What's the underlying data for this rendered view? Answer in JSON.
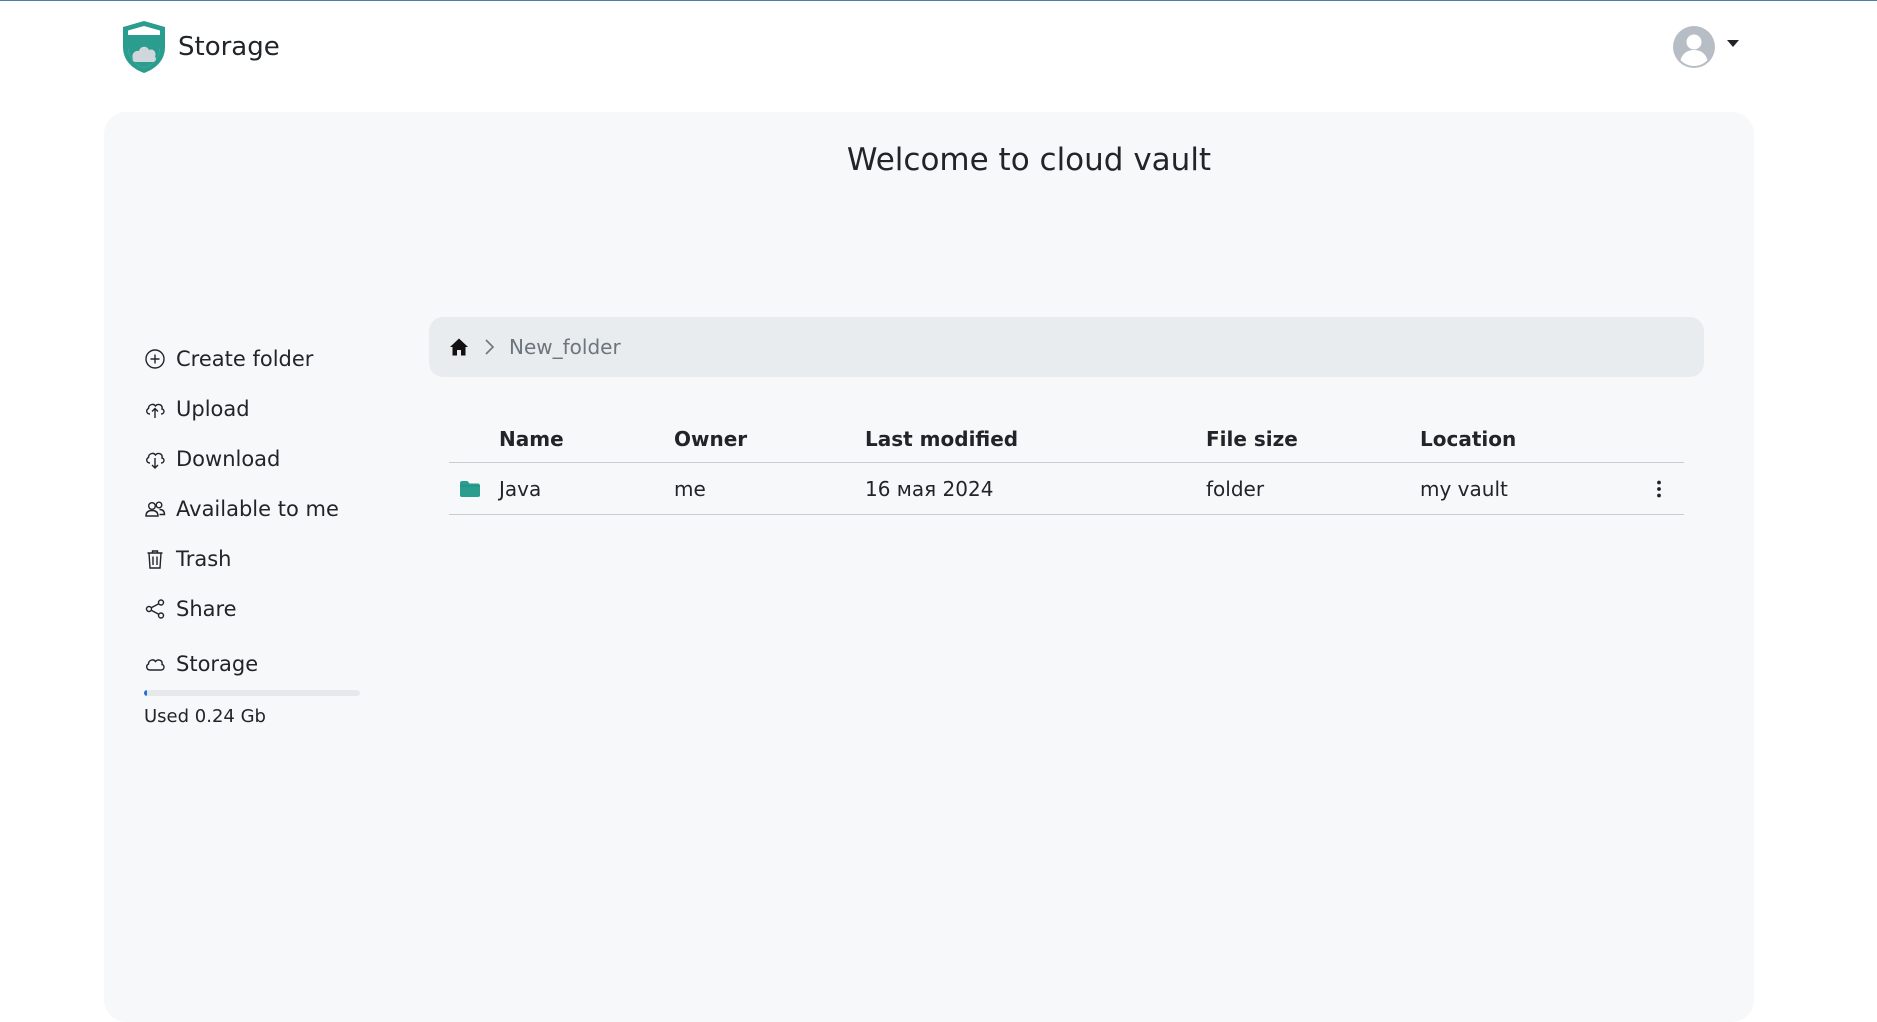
{
  "brand": {
    "title": "Storage",
    "logo_icon": "shield-cloud-logo"
  },
  "user_menu": {
    "avatar_icon": "user-avatar-icon",
    "caret_icon": "caret-down-icon"
  },
  "main": {
    "welcome": "Welcome to cloud vault"
  },
  "sidebar": {
    "items": [
      {
        "label": "Create folder",
        "icon": "plus-circle-icon"
      },
      {
        "label": "Upload",
        "icon": "cloud-upload-icon"
      },
      {
        "label": "Download",
        "icon": "cloud-download-icon"
      },
      {
        "label": "Available to me",
        "icon": "people-icon"
      },
      {
        "label": "Trash",
        "icon": "trash-icon"
      },
      {
        "label": "Share",
        "icon": "share-icon"
      }
    ],
    "storage": {
      "label": "Storage",
      "icon": "cloud-icon",
      "used_text": "Used 0.24 Gb",
      "used_fraction": 0.01
    }
  },
  "breadcrumb": {
    "home_icon": "home-icon",
    "separator_icon": "chevron-right-icon",
    "folder": "New_folder"
  },
  "table": {
    "headers": {
      "name": "Name",
      "owner": "Owner",
      "modified": "Last modified",
      "size": "File size",
      "location": "Location"
    },
    "rows": [
      {
        "icon": "folder-icon",
        "name": "Java",
        "owner": "me",
        "modified": "16 мая 2024",
        "size": "folder",
        "location": "my vault",
        "menu_icon": "kebab-menu-icon"
      }
    ]
  },
  "colors": {
    "accent": "#2a9d8f",
    "progress": "#1f6fd6",
    "panel_bg": "#f7f8fa",
    "breadcrumb_bg": "#e9ecef"
  }
}
